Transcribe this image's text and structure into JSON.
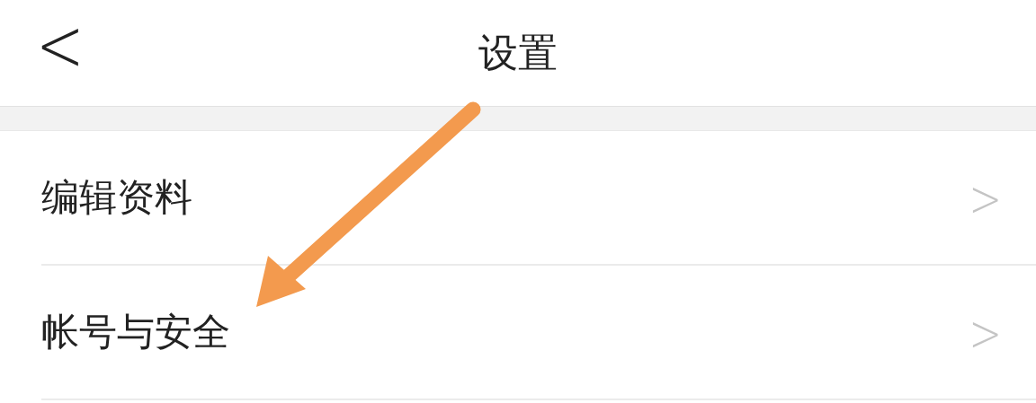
{
  "header": {
    "back": "<",
    "title": "设置"
  },
  "items": [
    {
      "label": "编辑资料",
      "chevron": ">"
    },
    {
      "label": "帐号与安全",
      "chevron": ">"
    }
  ]
}
